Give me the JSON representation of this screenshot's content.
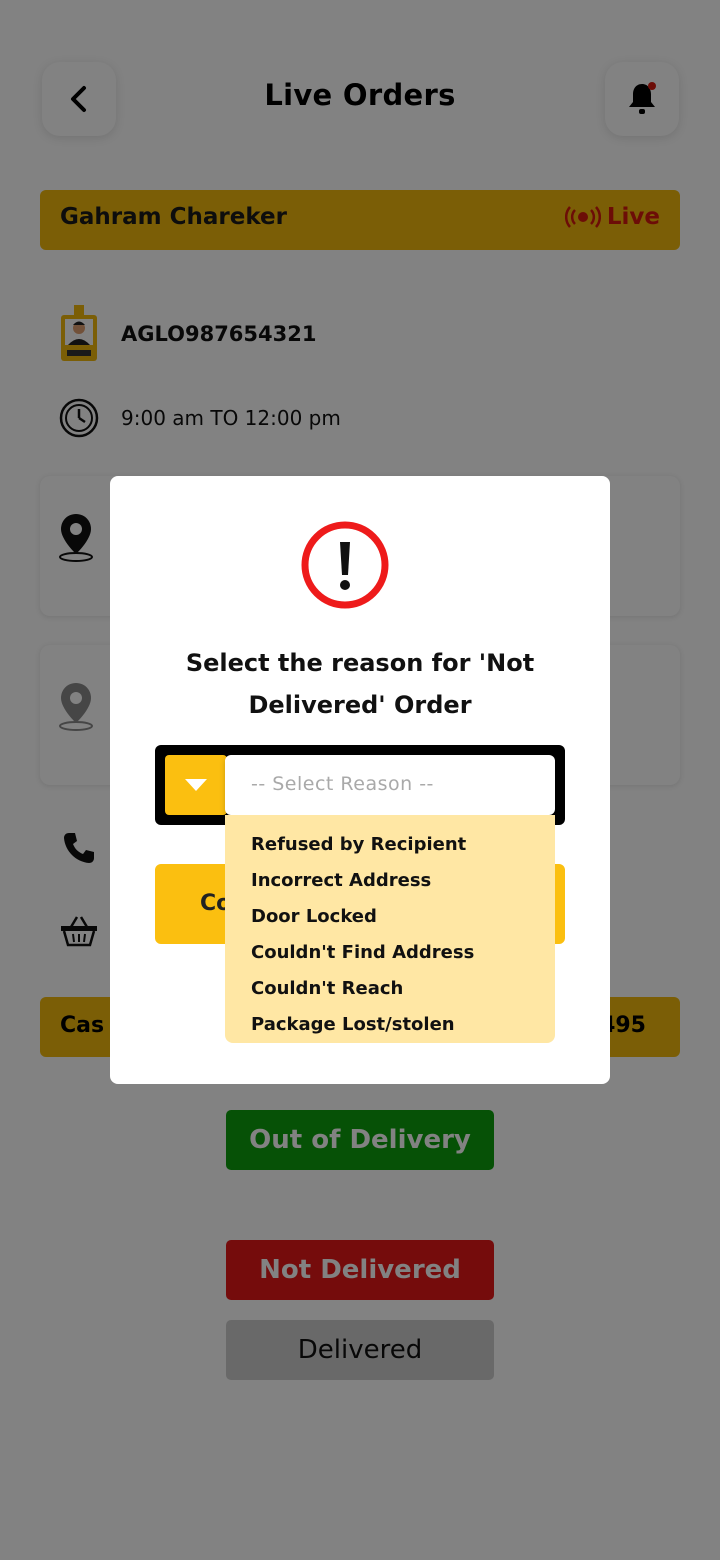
{
  "header": {
    "title": "Live Orders",
    "back_icon": "chevron-left-icon",
    "bell_icon": "bell-icon"
  },
  "customer": {
    "name": "Gahram Chareker",
    "status": "Live",
    "status_color": "#d51b0e",
    "bar_color": "#f2b90c"
  },
  "order": {
    "id": "AGLO987654321",
    "time_window": "9:00 am TO 12:00 pm"
  },
  "cash": {
    "label_visible": "Cas",
    "amount_visible": "495"
  },
  "status_buttons": {
    "out_for_delivery": "Out of Delivery",
    "not_delivered": "Not Delivered",
    "delivered": "Delivered"
  },
  "modal": {
    "title": "Select the reason for 'Not Delivered' Order",
    "alert_icon": "exclamation-circle-icon",
    "select_placeholder": "-- Select Reason --",
    "confirm_label_visible": "Co",
    "reasons": [
      "Refused by Recipient",
      "Incorrect Address",
      "Door Locked",
      "Couldn't Find Address",
      "Couldn't Reach",
      "Package Lost/stolen"
    ]
  },
  "colors": {
    "accent_yellow": "#fbbf10",
    "alert_red": "#ee1b1b",
    "success_green": "#0c9f0c",
    "danger_red": "#e51818"
  }
}
